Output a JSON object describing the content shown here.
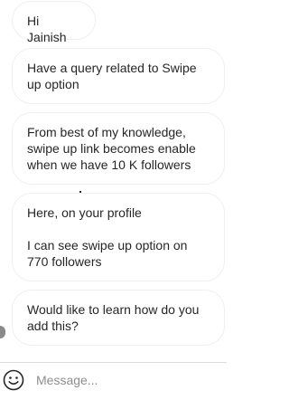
{
  "messages": [
    {
      "text": "Hi Jainish"
    },
    {
      "text": "Have a query related to Swipe up option"
    },
    {
      "text": "From best of my knowledge, swipe up link becomes enable when we have 10 K followers"
    },
    {
      "text": "Here, on your profile\n\nI can see swipe up option on 770 followers"
    },
    {
      "text": "Would like to learn how do you add this?"
    }
  ],
  "composer": {
    "placeholder": "Message...",
    "value": "",
    "icon": "emoji-icon"
  },
  "colors": {
    "bubble_border": "#efefef",
    "text": "#262626",
    "placeholder": "#8e8e8e",
    "divider": "#dbdbdb"
  }
}
